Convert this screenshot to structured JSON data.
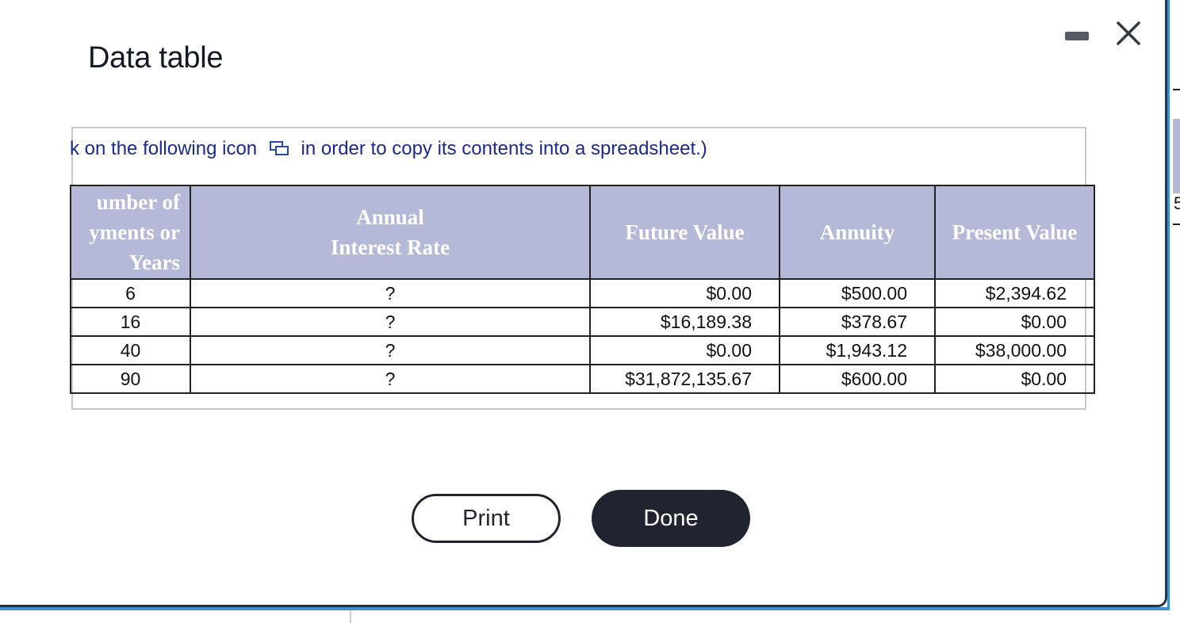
{
  "dialog": {
    "title": "Data table",
    "instructions_start": "k on the following icon",
    "instructions_end": "in order to copy its contents into a spreadsheet.)",
    "icons": {
      "minimize": "minimize-icon",
      "close": "close-icon",
      "copy": "copy-icon"
    }
  },
  "table": {
    "headers": {
      "years": [
        "umber of",
        "yments or",
        "Years"
      ],
      "rate": [
        "Annual",
        "Interest Rate"
      ],
      "future_value": "Future Value",
      "annuity": "Annuity",
      "present_value": "Present Value"
    },
    "rows": [
      {
        "years": "6",
        "rate": "?",
        "future_value": "$0.00",
        "annuity": "$500.00",
        "present_value": "$2,394.62"
      },
      {
        "years": "16",
        "rate": "?",
        "future_value": "$16,189.38",
        "annuity": "$378.67",
        "present_value": "$0.00"
      },
      {
        "years": "40",
        "rate": "?",
        "future_value": "$0.00",
        "annuity": "$1,943.12",
        "present_value": "$38,000.00"
      },
      {
        "years": "90",
        "rate": "?",
        "future_value": "$31,872,135.67",
        "annuity": "$600.00",
        "present_value": "$0.00"
      }
    ]
  },
  "buttons": {
    "print": "Print",
    "done": "Done"
  },
  "background_fragment": "5",
  "colors": {
    "header_bg": "#b6b8d8",
    "primary_button": "#1f2430",
    "link_text": "#1a2a8c",
    "accent_edge": "#3b8fd0"
  }
}
